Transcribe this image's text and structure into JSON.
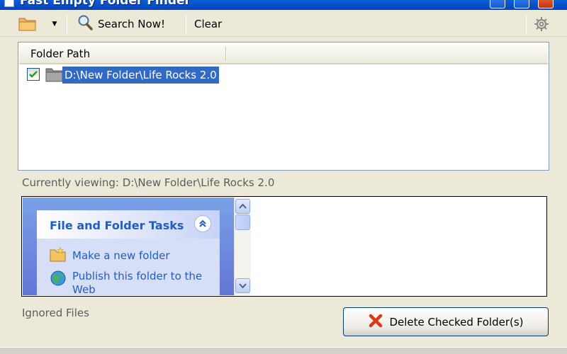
{
  "window": {
    "title": "Fast Empty Folder Finder"
  },
  "toolbar": {
    "search_label": "Search Now!",
    "clear_label": "Clear"
  },
  "folder_list": {
    "columns": [
      "Folder Path"
    ],
    "rows": [
      {
        "checked": true,
        "path": "D:\\New Folder\\Life Rocks 2.0"
      }
    ]
  },
  "status": {
    "text": "Currently viewing: D:\\New Folder\\Life Rocks 2.0"
  },
  "preview": {
    "task_header": "File and Folder Tasks",
    "tasks": [
      "Make a new folder",
      "Publish this folder to the Web"
    ]
  },
  "footer": {
    "ignored_label": "Ignored Files",
    "delete_label": "Delete Checked Folder(s)"
  },
  "colors": {
    "selection": "#316ac5",
    "xp_blue": "#215dc6",
    "titlebar": "#0a5fd8"
  }
}
